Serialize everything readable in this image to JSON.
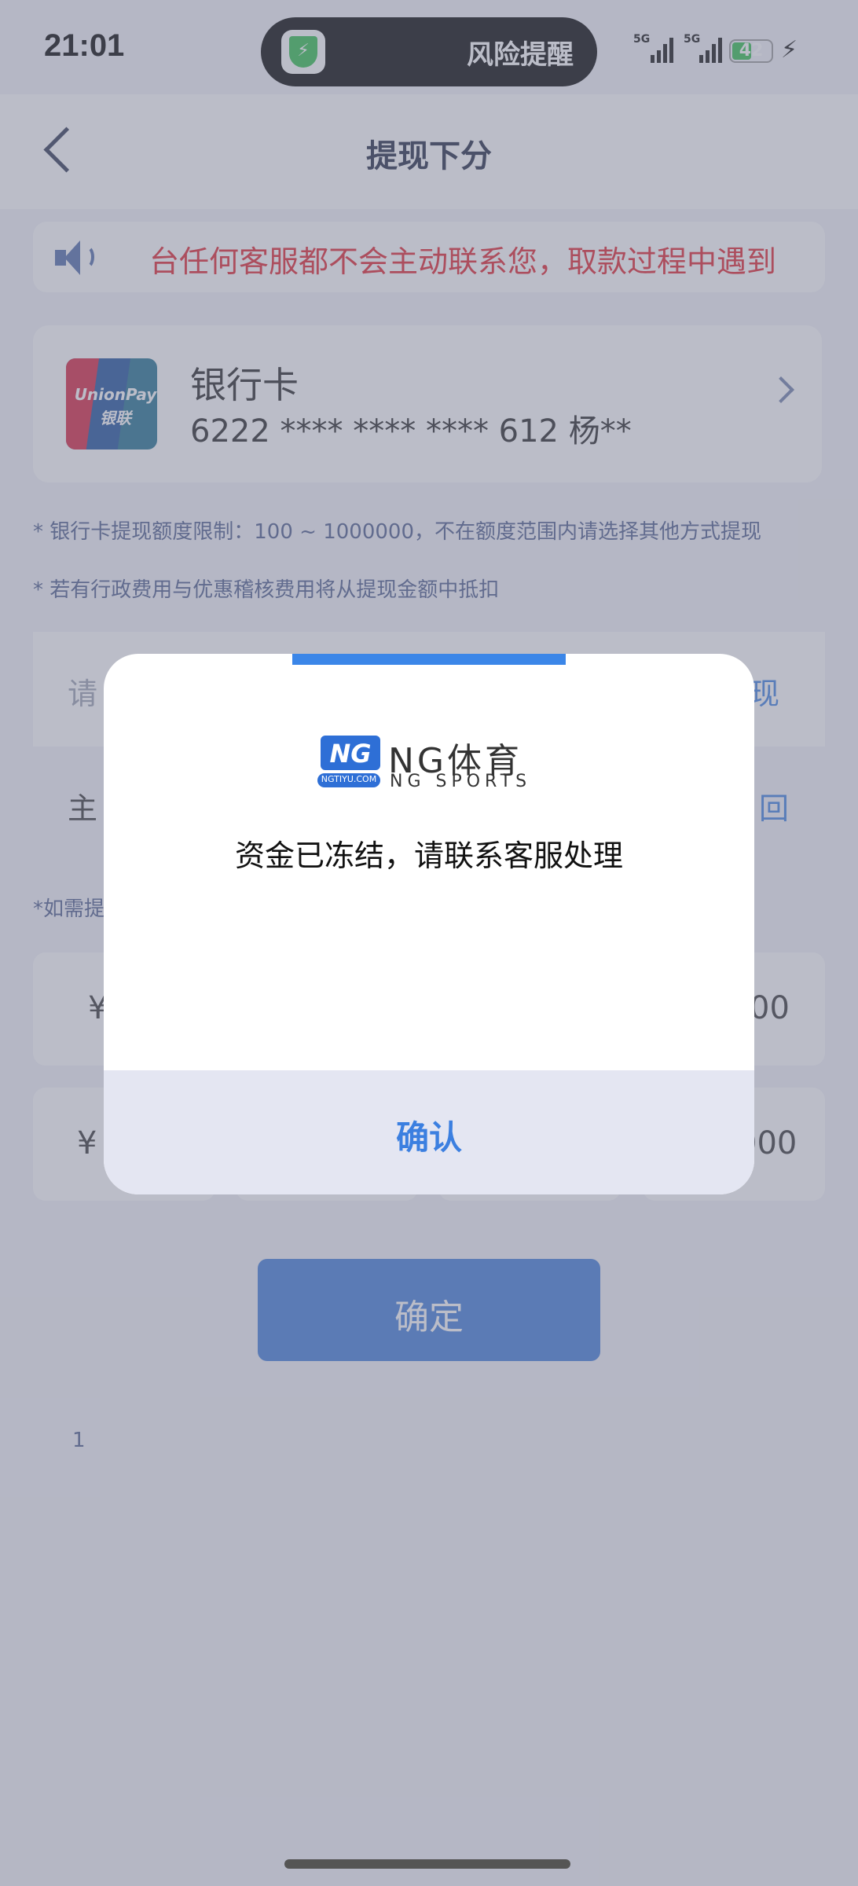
{
  "status_bar": {
    "time": "21:01",
    "island_text": "风险提醒",
    "signal_1_label": "5G",
    "signal_2_label": "5G",
    "battery": "42"
  },
  "header": {
    "title": "提现下分"
  },
  "notice": {
    "text": "台任何客服都不会主动联系您，取款过程中遇到"
  },
  "bank_card": {
    "title": "银行卡",
    "number": "6222 **** **** **** 612 杨**",
    "logo_text_1": "UnionPay",
    "logo_text_2": "银联"
  },
  "hints": {
    "limit": "* 银行卡提现额度限制：100 ~ 1000000，不在额度范围内请选择其他方式提现",
    "fee": "* 若有行政费用与优惠稽核费用将从提现金额中抵扣"
  },
  "amount_row": {
    "left_text": "请",
    "right_text": "现"
  },
  "wallet_row": {
    "left_text": "主",
    "right_text": "回"
  },
  "extra_hint": "*如需提",
  "quick_amounts": {
    "row1_left": "¥",
    "row1_right": "00",
    "row2_left": "¥",
    "row2_right": "000"
  },
  "confirm_button": "确定",
  "footer_number": "1",
  "dialog": {
    "brand_logo": "NG",
    "brand_url": "NGTIYU.COM",
    "brand_name": "NG体育",
    "brand_sub": "NG SPORTS",
    "message": "资金已冻结，请联系客服处理",
    "button": "确认"
  },
  "colors": {
    "accent": "#3b7fe0",
    "notice_red": "#e0202a",
    "battery_green": "#2fbf4a"
  }
}
